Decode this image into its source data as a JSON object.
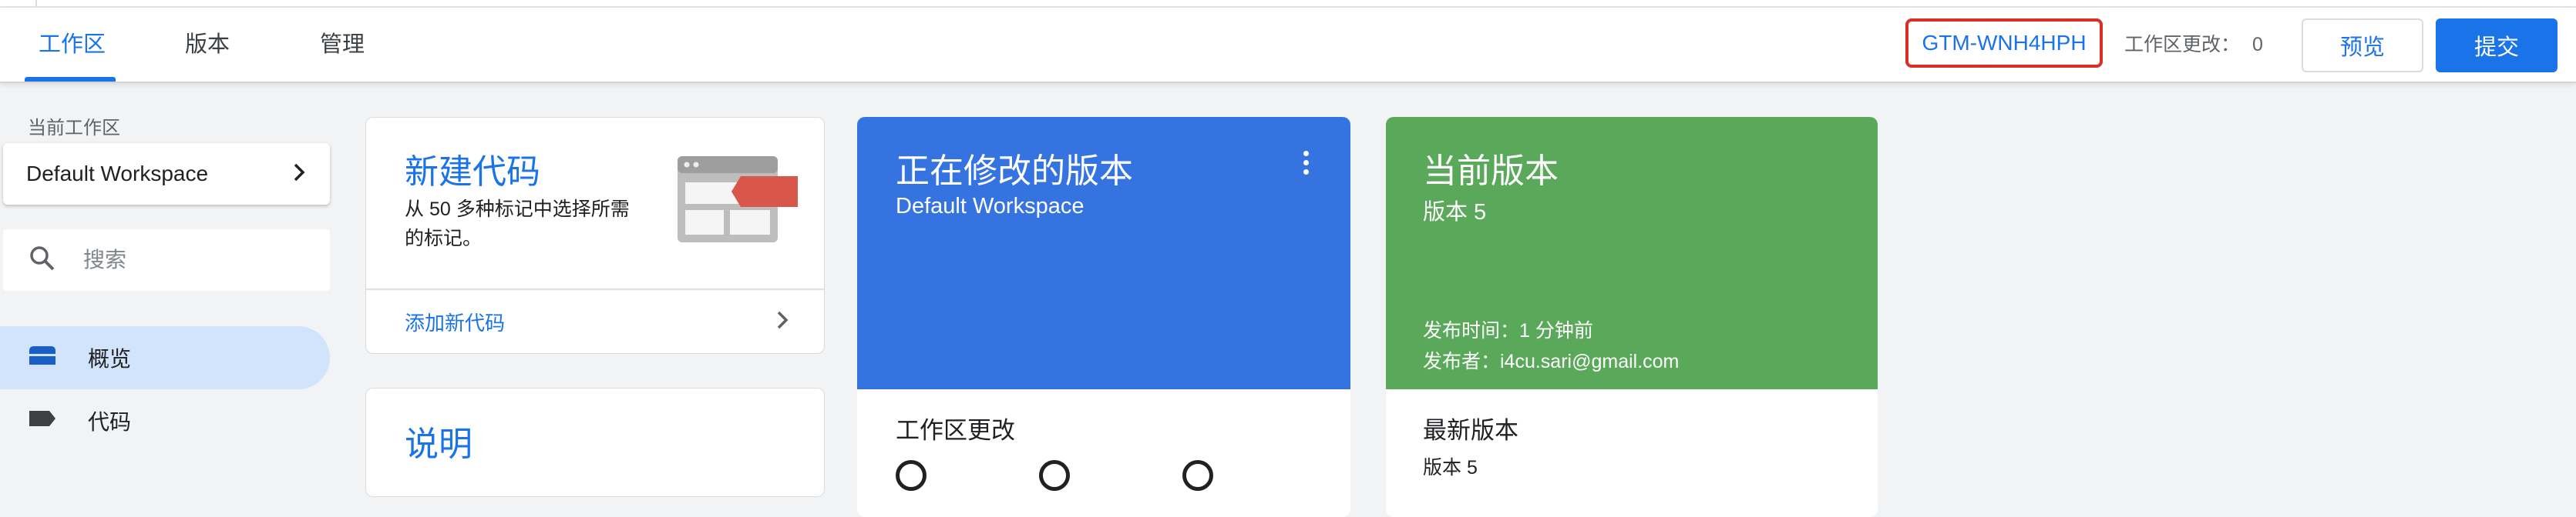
{
  "header": {
    "tabs": [
      {
        "label": "工作区",
        "active": true
      },
      {
        "label": "版本",
        "active": false
      },
      {
        "label": "管理",
        "active": false
      }
    ],
    "container_id": "GTM-WNH4HPH",
    "workspace_changes_label": "工作区更改：",
    "workspace_changes_count": "0",
    "preview_label": "预览",
    "submit_label": "提交"
  },
  "sidebar": {
    "current_workspace_label": "当前工作区",
    "workspace_name": "Default Workspace",
    "search_placeholder": "搜索",
    "items": [
      {
        "label": "概览",
        "icon": "overview-icon",
        "active": true
      },
      {
        "label": "代码",
        "icon": "tag-icon",
        "active": false
      }
    ]
  },
  "cards": {
    "new_tag": {
      "title": "新建代码",
      "description": "从 50 多种标记中选择所需的标记。",
      "link": "添加新代码"
    },
    "description_card": {
      "title": "说明"
    },
    "editing_version": {
      "title": "正在修改的版本",
      "subtitle": "Default Workspace",
      "section_title": "工作区更改"
    },
    "current_version": {
      "title": "当前版本",
      "subtitle": "版本 5",
      "published_time": "发布时间：1 分钟前",
      "published_by": "发布者：i4cu.sari@gmail.com",
      "latest_title": "最新版本",
      "latest_sub": "版本 5"
    }
  },
  "colors": {
    "accent": "#1a73e8",
    "editing_card": "#3574e0",
    "current_card": "#5aa85a",
    "highlight_border": "#d93025"
  }
}
